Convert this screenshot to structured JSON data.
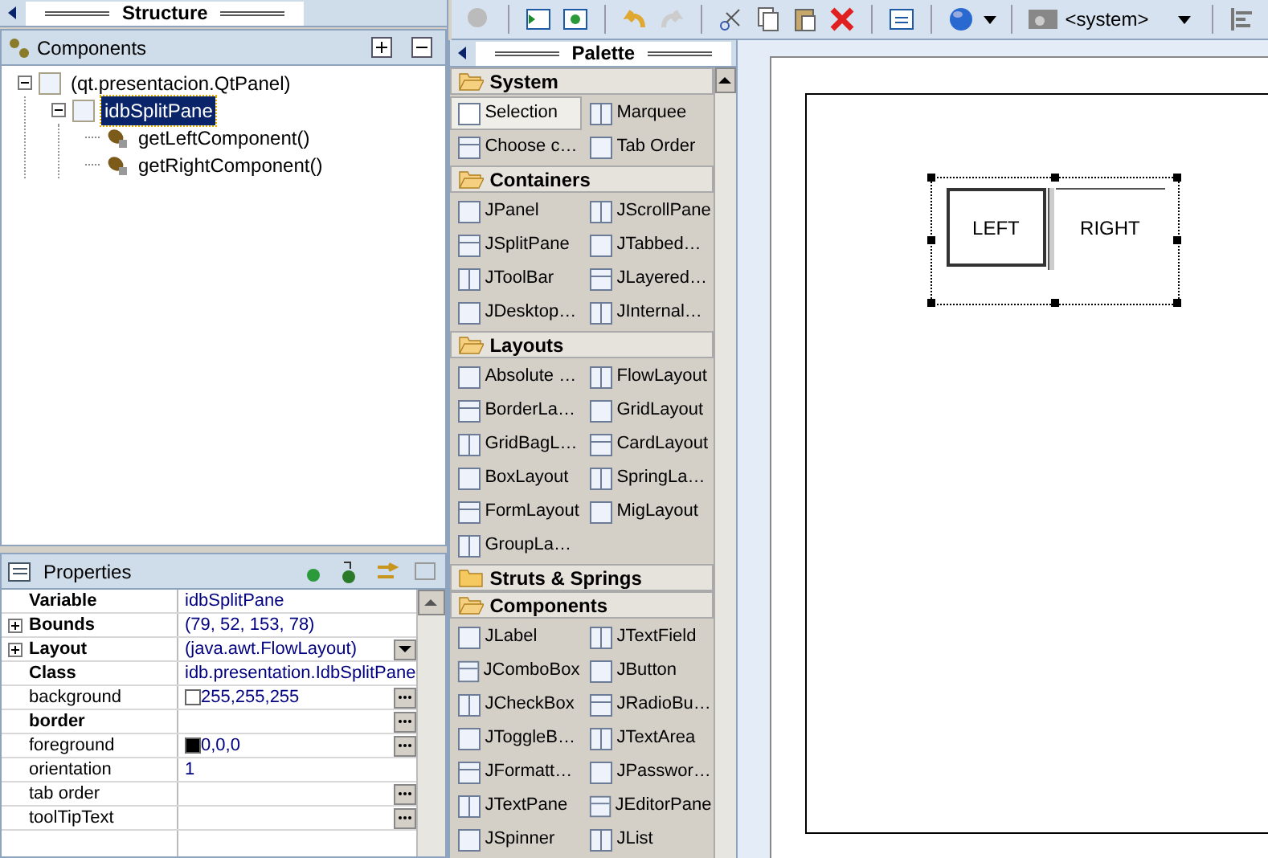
{
  "structure": {
    "title": "Structure",
    "components_label": "Components",
    "tree": [
      {
        "label": "(qt.presentacion.QtPanel)",
        "kind": "panel",
        "expanded": true,
        "selected": false,
        "children": [
          {
            "label": "idbSplitPane",
            "kind": "panel",
            "expanded": true,
            "selected": true,
            "children": [
              {
                "label": "getLeftComponent()",
                "kind": "method",
                "selected": false
              },
              {
                "label": "getRightComponent()",
                "kind": "method",
                "selected": false
              }
            ]
          }
        ]
      }
    ]
  },
  "properties": {
    "title": "Properties",
    "rows": [
      {
        "name": "Variable",
        "value": "idbSplitPane",
        "bold": true
      },
      {
        "name": "Bounds",
        "value": "(79, 52, 153, 78)",
        "bold": true,
        "expandable": true
      },
      {
        "name": "Layout",
        "value": "(java.awt.FlowLayout)",
        "bold": true,
        "expandable": true,
        "dropdown_button": true
      },
      {
        "name": "Class",
        "value": "idb.presentation.IdbSplitPane",
        "bold": true
      },
      {
        "name": "background",
        "value": "255,255,255",
        "bold": false,
        "color": "#ffffff",
        "dialog_button": true
      },
      {
        "name": "border",
        "value": "",
        "bold": true,
        "dialog_button": true
      },
      {
        "name": "foreground",
        "value": "0,0,0",
        "bold": false,
        "color": "#000000",
        "dialog_button": true
      },
      {
        "name": "orientation",
        "value": "1",
        "bold": false
      },
      {
        "name": "tab order",
        "value": "",
        "bold": false,
        "dialog_button": true
      },
      {
        "name": "toolTipText",
        "value": "",
        "bold": false,
        "dialog_button": true
      }
    ]
  },
  "toolbar": {
    "look_and_feel": "<system>"
  },
  "palette": {
    "title": "Palette",
    "sections": [
      {
        "name": "System",
        "expanded": true,
        "items": [
          {
            "label": "Selection",
            "selected": true
          },
          {
            "label": "Marquee",
            "selected": false
          },
          {
            "label": "Choose c…",
            "selected": false
          },
          {
            "label": "Tab Order",
            "selected": false
          }
        ]
      },
      {
        "name": "Containers",
        "expanded": true,
        "items": [
          {
            "label": "JPanel",
            "selected": false
          },
          {
            "label": "JScrollPane",
            "selected": false
          },
          {
            "label": "JSplitPane",
            "selected": false
          },
          {
            "label": "JTabbed…",
            "selected": false
          },
          {
            "label": "JToolBar",
            "selected": false
          },
          {
            "label": "JLayered…",
            "selected": false
          },
          {
            "label": "JDesktop…",
            "selected": false
          },
          {
            "label": "JInternal…",
            "selected": false
          }
        ]
      },
      {
        "name": "Layouts",
        "expanded": true,
        "items": [
          {
            "label": "Absolute …",
            "selected": false
          },
          {
            "label": "FlowLayout",
            "selected": false
          },
          {
            "label": "BorderLa…",
            "selected": false
          },
          {
            "label": "GridLayout",
            "selected": false
          },
          {
            "label": "GridBagL…",
            "selected": false
          },
          {
            "label": "CardLayout",
            "selected": false
          },
          {
            "label": "BoxLayout",
            "selected": false
          },
          {
            "label": "SpringLa…",
            "selected": false
          },
          {
            "label": "FormLayout",
            "selected": false
          },
          {
            "label": "MigLayout",
            "selected": false
          },
          {
            "label": "GroupLa…",
            "selected": false
          }
        ]
      },
      {
        "name": "Struts & Springs",
        "expanded": false
      },
      {
        "name": "Components",
        "expanded": true,
        "items": [
          {
            "label": "JLabel",
            "selected": false
          },
          {
            "label": "JTextField",
            "selected": false
          },
          {
            "label": "JComboBox",
            "selected": false
          },
          {
            "label": "JButton",
            "selected": false
          },
          {
            "label": "JCheckBox",
            "selected": false
          },
          {
            "label": "JRadioBu…",
            "selected": false
          },
          {
            "label": "JToggleB…",
            "selected": false
          },
          {
            "label": "JTextArea",
            "selected": false
          },
          {
            "label": "JFormatt…",
            "selected": false
          },
          {
            "label": "JPasswor…",
            "selected": false
          },
          {
            "label": "JTextPane",
            "selected": false
          },
          {
            "label": "JEditorPane",
            "selected": false
          },
          {
            "label": "JSpinner",
            "selected": false
          },
          {
            "label": "JList",
            "selected": false
          }
        ]
      }
    ]
  },
  "canvas": {
    "left_label": "LEFT",
    "right_label": "RIGHT"
  }
}
